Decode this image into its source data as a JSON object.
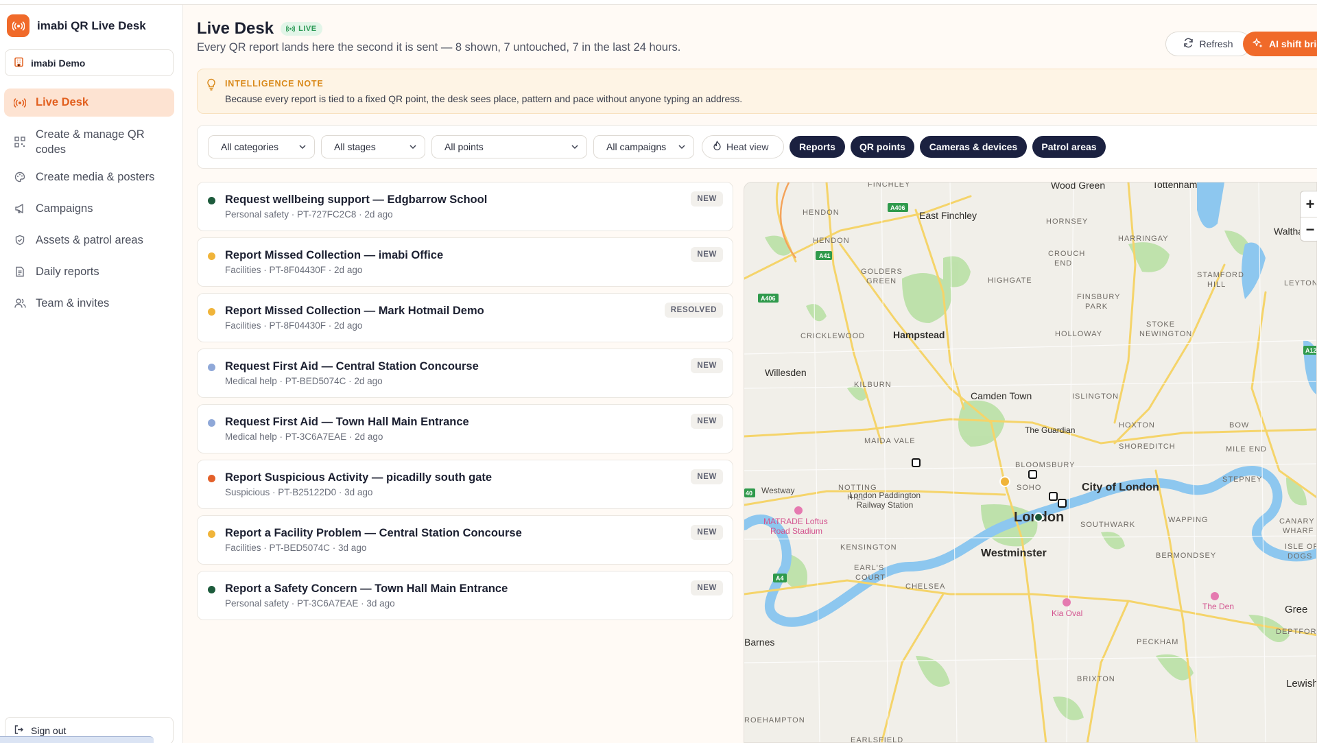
{
  "app": {
    "name": "imabi QR Live Desk"
  },
  "org": {
    "name": "imabi Demo"
  },
  "nav": [
    {
      "label": "Live Desk",
      "icon": "broadcast-icon",
      "active": true
    },
    {
      "label": "Create & manage QR codes",
      "icon": "qr-code-icon"
    },
    {
      "label": "Create media & posters",
      "icon": "palette-icon"
    },
    {
      "label": "Campaigns",
      "icon": "megaphone-icon"
    },
    {
      "label": "Assets & patrol areas",
      "icon": "shield-icon"
    },
    {
      "label": "Daily reports",
      "icon": "document-icon"
    },
    {
      "label": "Team & invites",
      "icon": "users-icon"
    }
  ],
  "signout": {
    "label": "Sign out"
  },
  "header": {
    "title": "Live Desk",
    "live_badge": "LIVE",
    "subtitle": "Every QR report lands here the second it is sent — 8 shown, 7 untouched, 7 in the last 24 hours.",
    "refresh_label": "Refresh",
    "ai_label": "AI shift brie"
  },
  "note": {
    "title": "INTELLIGENCE NOTE",
    "text": "Because every report is tied to a fixed QR point, the desk sees place, pattern and pace without anyone typing an address."
  },
  "filters": {
    "category": "All categories",
    "stage": "All stages",
    "point": "All points",
    "campaign": "All campaigns",
    "heat": "Heat view",
    "layers": [
      "Reports",
      "QR points",
      "Cameras & devices",
      "Patrol areas"
    ]
  },
  "reports": [
    {
      "title": "Request wellbeing support — Edgbarrow School",
      "meta": "Personal safety · PT-727FC2C8 · 2d ago",
      "status": "NEW",
      "color": "#1d5b3c"
    },
    {
      "title": "Report Missed Collection — imabi Office",
      "meta": "Facilities · PT-8F04430F · 2d ago",
      "status": "NEW",
      "color": "#f0b43a"
    },
    {
      "title": "Report Missed Collection — Mark Hotmail Demo",
      "meta": "Facilities · PT-8F04430F · 2d ago",
      "status": "RESOLVED",
      "color": "#f0b43a"
    },
    {
      "title": "Request First Aid — Central Station Concourse",
      "meta": "Medical help · PT-BED5074C · 2d ago",
      "status": "NEW",
      "color": "#8fa8d8"
    },
    {
      "title": "Request First Aid — Town Hall Main Entrance",
      "meta": "Medical help · PT-3C6A7EAE · 2d ago",
      "status": "NEW",
      "color": "#8fa8d8"
    },
    {
      "title": "Report Suspicious Activity — picadilly south gate",
      "meta": "Suspicious · PT-B25122D0 · 3d ago",
      "status": "NEW",
      "color": "#e3602a"
    },
    {
      "title": "Report a Facility Problem — Central Station Concourse",
      "meta": "Facilities · PT-BED5074C · 3d ago",
      "status": "NEW",
      "color": "#f0b43a"
    },
    {
      "title": "Report a Safety Concern — Town Hall Main Entrance",
      "meta": "Personal safety · PT-3C6A7EAE · 3d ago",
      "status": "NEW",
      "color": "#1d5b3c"
    }
  ],
  "map": {
    "zoom_in": "+",
    "zoom_out": "−",
    "labels": {
      "finchley": "FINCHLEY",
      "wood_green": "Wood Green",
      "tottenham": "Tottenham",
      "hendon1": "HENDON",
      "hendon2": "HENDON",
      "east_finchley": "East Finchley",
      "hornsey": "HORNSEY",
      "harringay": "HARRINGAY",
      "crouch_end": "CROUCH",
      "crouch_end2": "END",
      "walthamstow": "Walthamstow",
      "golders": "GOLDERS",
      "golders2": "GREEN",
      "highgate": "HIGHGATE",
      "stamford": "STAMFORD",
      "stamford2": "HILL",
      "leyton": "LEYTON",
      "finsbury": "FINSBURY",
      "finsbury2": "PARK",
      "cricklewood": "CRICKLEWOOD",
      "hampstead": "Hampstead",
      "holloway": "HOLLOWAY",
      "stoke": "STOKE",
      "stoke2": "NEWINGTON",
      "willesden": "Willesden",
      "kilburn": "KILBURN",
      "camden": "Camden Town",
      "islington": "ISLINGTON",
      "guardian": "The Guardian",
      "hoxton": "HOXTON",
      "bow": "BOW",
      "maida": "MAIDA VALE",
      "shoreditch": "SHOREDITCH",
      "mile_end": "MILE END",
      "bloomsbury": "BLOOMSBURY",
      "westway": "Westway",
      "notting": "NOTTING",
      "notting2": "HILL",
      "paddington": "London Paddington",
      "paddington2": "Railway Station",
      "soho": "SOHO",
      "city": "City of London",
      "stepney": "STEPNEY",
      "matrade": "MATRADE Loftus",
      "matrade2": "Road Stadium",
      "london": "London",
      "southwark": "SOUTHWARK",
      "wapping": "WAPPING",
      "canary": "CANARY",
      "canary2": "WHARF",
      "kensington": "KENSINGTON",
      "westminster": "Westminster",
      "bermondsey": "BERMONDSEY",
      "isle": "ISLE OF",
      "isle2": "DOGS",
      "earls": "EARL'S",
      "earls2": "COURT",
      "chelsea": "CHELSEA",
      "kia": "Kia Oval",
      "the_den": "The Den",
      "greenwich": "Gree",
      "deptford": "DEPTFORD",
      "barnes": "Barnes",
      "peckham": "PECKHAM",
      "brixton": "BRIXTON",
      "lewisham": "Lewish",
      "roehampton": "ROEHAMPTON",
      "earlsfield": "EARLSFIELD",
      "a406a": "A406",
      "a406b": "A406",
      "a41": "A41",
      "a4": "A4",
      "a12": "A12",
      "a40": "40"
    }
  }
}
